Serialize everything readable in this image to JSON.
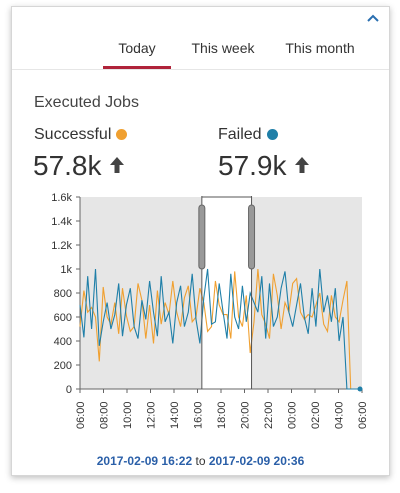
{
  "tabs": [
    {
      "label": "Today",
      "active": true
    },
    {
      "label": "This week",
      "active": false
    },
    {
      "label": "This month",
      "active": false
    }
  ],
  "section_title": "Executed Jobs",
  "successful": {
    "label": "Successful",
    "value": "57.8k",
    "color": "#f0a030",
    "trend": "up"
  },
  "failed": {
    "label": "Failed",
    "value": "57.9k",
    "color": "#1f7fa8",
    "trend": "up"
  },
  "range": {
    "from": "2017-02-09 16:22",
    "to_word": "to",
    "to": "2017-02-09 20:36"
  },
  "chart_data": {
    "type": "line",
    "x_ticks": [
      "06:00",
      "08:00",
      "10:00",
      "12:00",
      "14:00",
      "16:00",
      "18:00",
      "20:00",
      "22:00",
      "00:00",
      "02:00",
      "04:00",
      "06:00"
    ],
    "y_ticks": [
      "0",
      "200",
      "400",
      "600",
      "800",
      "1k",
      "1.2k",
      "1.4k",
      "1.6k"
    ],
    "ylim": [
      0,
      1600
    ],
    "xlim_hours": [
      0,
      24
    ],
    "selection_hours": [
      10.37,
      14.6
    ],
    "series": [
      {
        "name": "Successful",
        "color": "#f0a030",
        "values": [
          520,
          820,
          640,
          680,
          600,
          230,
          850,
          600,
          540,
          720,
          460,
          840,
          610,
          480,
          520,
          880,
          740,
          420,
          700,
          380,
          820,
          540,
          720,
          620,
          900,
          640,
          520,
          760,
          860,
          560,
          600,
          840,
          720,
          480,
          520,
          900,
          700,
          620,
          620,
          420,
          980,
          600,
          520,
          780,
          300,
          560,
          1000,
          620,
          540,
          420,
          960,
          780,
          500,
          720,
          640,
          880,
          920,
          640,
          580,
          620,
          600,
          700,
          800,
          540,
          480,
          780,
          600,
          560,
          740,
          900,
          0,
          0,
          0
        ]
      },
      {
        "name": "Failed",
        "color": "#1f7fa8",
        "values": [
          700,
          430,
          940,
          500,
          1000,
          360,
          560,
          720,
          500,
          620,
          880,
          440,
          700,
          840,
          520,
          420,
          740,
          580,
          900,
          640,
          440,
          940,
          560,
          640,
          380,
          720,
          860,
          520,
          640,
          960,
          580,
          380,
          760,
          1000,
          540,
          560,
          880,
          640,
          420,
          960,
          600,
          500,
          860,
          560,
          800,
          720,
          640,
          940,
          420,
          880,
          520,
          600,
          840,
          980,
          640,
          520,
          700,
          880,
          600,
          460,
          840,
          520,
          1000,
          640,
          780,
          560,
          840,
          400,
          600,
          0,
          0,
          0,
          0
        ]
      }
    ]
  }
}
